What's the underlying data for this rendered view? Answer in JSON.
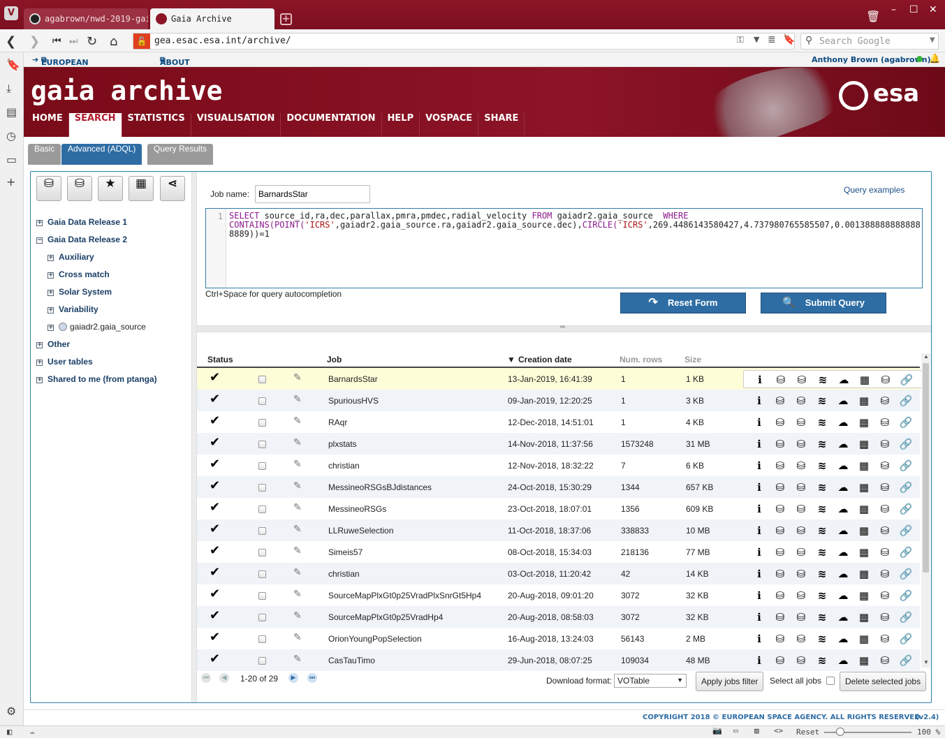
{
  "browser": {
    "tabs": [
      {
        "label": "agabrown/nwd-2019-gai:"
      },
      {
        "label": "Gaia Archive"
      }
    ],
    "url": "gea.esac.esa.int/archive/",
    "search_placeholder": "Search Google",
    "zoom": "100 %",
    "reset": "Reset"
  },
  "esa_top": {
    "links": [
      "EUROPEAN SPACE AGENCY",
      "ABOUT ESAC"
    ],
    "user": "Anthony Brown (agabrown)"
  },
  "banner": {
    "title": "gaia archive",
    "logo_text": "esa"
  },
  "menu": [
    "HOME",
    "SEARCH",
    "STATISTICS",
    "VISUALISATION",
    "DOCUMENTATION",
    "HELP",
    "VOSPACE",
    "SHARE"
  ],
  "subtabs": [
    "Basic",
    "Advanced (ADQL)",
    "Query Results"
  ],
  "sidebar": {
    "tree": [
      {
        "label": "Gaia Data Release 1",
        "sign": "+"
      },
      {
        "label": "Gaia Data Release 2",
        "sign": "−"
      },
      {
        "label": "Auxiliary",
        "sign": "+"
      },
      {
        "label": "Cross match",
        "sign": "+"
      },
      {
        "label": "Solar System",
        "sign": "+"
      },
      {
        "label": "Variability",
        "sign": "+"
      },
      {
        "label": "gaiadr2.gaia_source",
        "sign": "+"
      },
      {
        "label": "Other",
        "sign": "+"
      },
      {
        "label": "User tables",
        "sign": "+"
      },
      {
        "label": "Shared to me (from ptanga)",
        "sign": "+"
      }
    ]
  },
  "query": {
    "job_name_label": "Job name:",
    "job_name": "BarnardsStar",
    "examples": "Query examples",
    "line_number": "1",
    "sql": {
      "p1": "SELECT",
      "p2": " source_id,ra,dec,parallax,pmra,pmdec,radial_velocity ",
      "p3": "FROM",
      "p4": " gaiadr2.gaia_source  ",
      "p5": "WHERE",
      "p6": "CONTAINS(POINT(",
      "p7": "'ICRS'",
      "p8": ",gaiadr2.gaia_source.ra,gaiadr2.gaia_source.dec),",
      "p9": "CIRCLE(",
      "p10": "'ICRS'",
      "p11": ",269.4486143580427,4.737980765585507,0.0013888888888888889))=1"
    },
    "hint": "Ctrl+Space for query autocompletion",
    "reset_label": "Reset Form",
    "submit_label": "Submit Query"
  },
  "jobs": {
    "headers": {
      "status": "Status",
      "job": "Job",
      "date": "Creation date",
      "rows": "Num. rows",
      "size": "Size"
    },
    "rows": [
      {
        "job": "BarnardsStar",
        "date": "13-Jan-2019, 16:41:39",
        "rows": "1",
        "size": "1 KB"
      },
      {
        "job": "SpuriousHVS",
        "date": "09-Jan-2019, 12:20:25",
        "rows": "1",
        "size": "3 KB"
      },
      {
        "job": "RAqr",
        "date": "12-Dec-2018, 14:51:01",
        "rows": "1",
        "size": "4 KB"
      },
      {
        "job": "plxstats",
        "date": "14-Nov-2018, 11:37:56",
        "rows": "1573248",
        "size": "31 MB"
      },
      {
        "job": "christian",
        "date": "12-Nov-2018, 18:32:22",
        "rows": "7",
        "size": "6 KB"
      },
      {
        "job": "MessineoRSGsBJdistances",
        "date": "24-Oct-2018, 15:30:29",
        "rows": "1344",
        "size": "657 KB"
      },
      {
        "job": "MessineoRSGs",
        "date": "23-Oct-2018, 18:07:01",
        "rows": "1356",
        "size": "609 KB"
      },
      {
        "job": "LLRuweSelection",
        "date": "11-Oct-2018, 18:37:06",
        "rows": "338833",
        "size": "10 MB"
      },
      {
        "job": "Simeis57",
        "date": "08-Oct-2018, 15:34:03",
        "rows": "218136",
        "size": "77 MB"
      },
      {
        "job": "christian",
        "date": "03-Oct-2018, 11:20:42",
        "rows": "42",
        "size": "14 KB"
      },
      {
        "job": "SourceMapPlxGt0p25VradPlxSnrGt5Hp4",
        "date": "20-Aug-2018, 09:01:20",
        "rows": "3072",
        "size": "32 KB"
      },
      {
        "job": "SourceMapPlxGt0p25VradHp4",
        "date": "20-Aug-2018, 08:58:03",
        "rows": "3072",
        "size": "32 KB"
      },
      {
        "job": "OrionYoungPopSelection",
        "date": "16-Aug-2018, 13:24:03",
        "rows": "56143",
        "size": "2 MB"
      },
      {
        "job": "CasTauTimo",
        "date": "29-Jun-2018, 08:07:25",
        "rows": "109034",
        "size": "48 MB"
      }
    ],
    "pager": "1-20 of 29",
    "download_label": "Download format:",
    "download_value": "VOTable",
    "apply_filter": "Apply jobs filter",
    "select_all": "Select all jobs",
    "delete_selected": "Delete selected jobs"
  },
  "footer": {
    "copyright": "COPYRIGHT 2018 © EUROPEAN SPACE AGENCY. ALL RIGHTS RESERVED.",
    "version": "(v2.4)"
  }
}
